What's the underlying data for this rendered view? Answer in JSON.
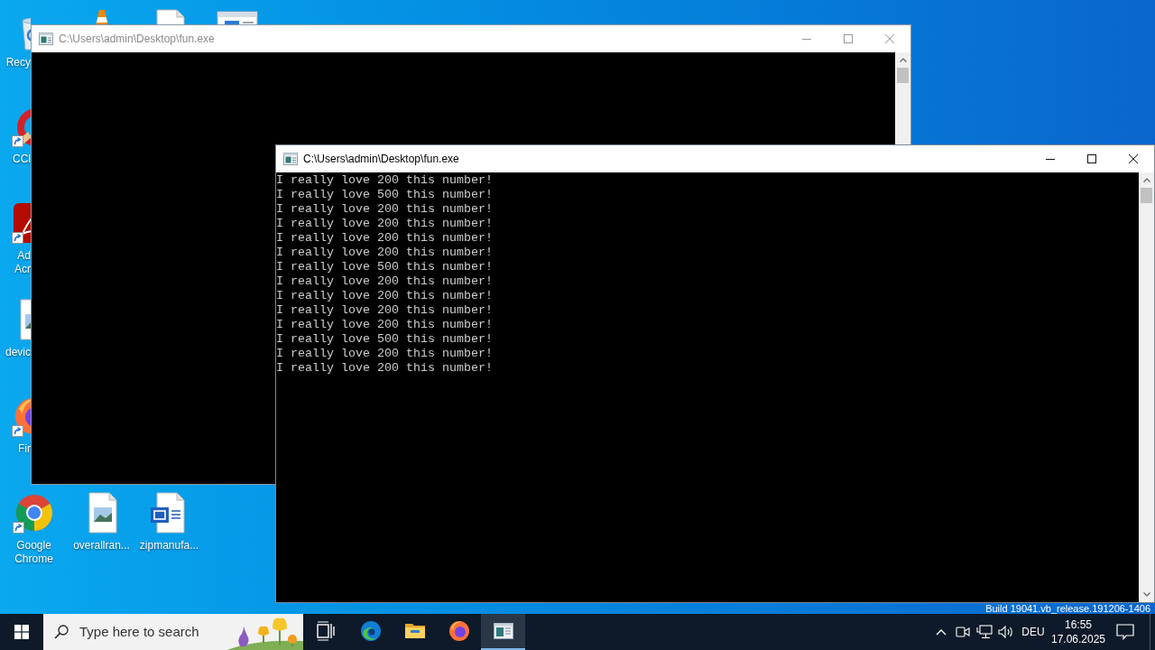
{
  "desktop": {
    "icon_rows": [
      [
        {
          "kind": "recycle-bin",
          "label": "Recy",
          "shortcut": false
        },
        {
          "kind": "vlc"
        },
        {
          "kind": "word-document"
        },
        {
          "kind": "app-window"
        }
      ],
      [
        {
          "kind": "ccleaner",
          "label": "CCl",
          "shortcut": true
        }
      ],
      [
        {
          "kind": "acrobat",
          "label": "Ad Acr",
          "shortcut": true
        }
      ],
      [
        {
          "kind": "image-file",
          "label": "devic",
          "shortcut": false
        }
      ],
      [
        {
          "kind": "firefox",
          "label": "Fir",
          "shortcut": true
        }
      ],
      [
        {
          "kind": "chrome",
          "label": "Google Chrome",
          "shortcut": true
        },
        {
          "kind": "image-file",
          "label": "overallran...",
          "shortcut": false
        },
        {
          "kind": "word-document",
          "label": "zipmanufa...",
          "shortcut": false
        }
      ]
    ],
    "build_info": "Build 19041.vb_release.191206-1406"
  },
  "windows": [
    {
      "title": "C:\\Users\\admin\\Desktop\\fun.exe",
      "active": false
    },
    {
      "title": "C:\\Users\\admin\\Desktop\\fun.exe",
      "active": true,
      "lines": [
        "I really love 200 this number!",
        "I really love 500 this number!",
        "I really love 200 this number!",
        "I really love 200 this number!",
        "I really love 200 this number!",
        "I really love 200 this number!",
        "I really love 500 this number!",
        "I really love 200 this number!",
        "I really love 200 this number!",
        "I really love 200 this number!",
        "I really love 200 this number!",
        "I really love 500 this number!",
        "I really love 200 this number!",
        "I really love 200 this number!"
      ]
    }
  ],
  "taskbar": {
    "search": {
      "placeholder": "Type here to search"
    },
    "apps": [
      {
        "kind": "task-view",
        "selected": false
      },
      {
        "kind": "edge",
        "selected": false
      },
      {
        "kind": "file-explorer",
        "selected": false
      },
      {
        "kind": "firefox",
        "selected": false
      },
      {
        "kind": "console",
        "selected": true
      }
    ],
    "tray": {
      "language": "DEU",
      "time": "16:55",
      "date": "17.06.2025"
    }
  }
}
